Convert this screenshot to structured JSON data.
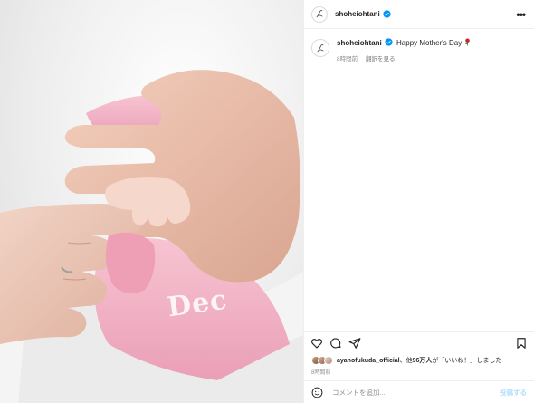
{
  "post": {
    "username": "shoheiohtani",
    "caption_text": "Happy Mother's Day",
    "time_ago": "8時間前",
    "translate_label": "翻訳を見る",
    "more_label": "•••"
  },
  "photo": {
    "onesie_text": "Dec"
  },
  "likes": {
    "liked_by_user": "ayanofukuda_official",
    "text_middle": "、他",
    "count": "96万人",
    "text_suffix": "が「いいね！」しました"
  },
  "timestamp": "8時間前",
  "comment": {
    "placeholder": "コメントを追加...",
    "post_label": "投稿する"
  },
  "colors": {
    "verified": "#0095f6",
    "rose": "#c62828",
    "post_button_disabled": "#b2dffc"
  },
  "icons": [
    "three-dots-icon",
    "verified-icon",
    "rose-emoji-icon",
    "heart-icon",
    "comment-icon",
    "share-icon",
    "bookmark-icon",
    "emoji-icon"
  ]
}
